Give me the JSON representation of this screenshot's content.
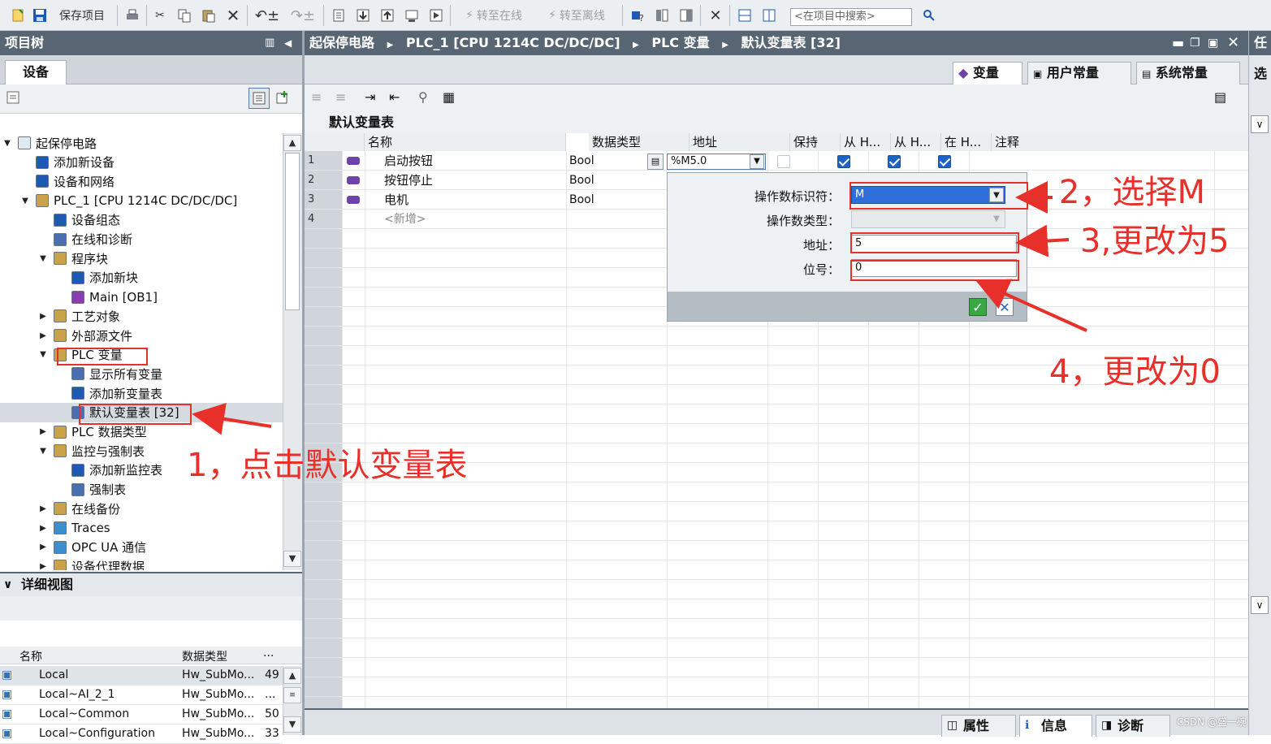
{
  "toolbar": {
    "save_project": "保存项目",
    "go_online": "转至在线",
    "go_offline": "转至离线",
    "search_placeholder": "<在项目中搜索>"
  },
  "project_tree": {
    "title": "项目树",
    "tab_devices": "设备",
    "items": [
      {
        "label": "起保停电路",
        "level": 0,
        "expand": "open"
      },
      {
        "label": "添加新设备",
        "level": 1,
        "expand": "none"
      },
      {
        "label": "设备和网络",
        "level": 1,
        "expand": "none"
      },
      {
        "label": "PLC_1 [CPU 1214C DC/DC/DC]",
        "level": 1,
        "expand": "open"
      },
      {
        "label": "设备组态",
        "level": 2,
        "expand": "none"
      },
      {
        "label": "在线和诊断",
        "level": 2,
        "expand": "none"
      },
      {
        "label": "程序块",
        "level": 2,
        "expand": "open"
      },
      {
        "label": "添加新块",
        "level": 3,
        "expand": "none"
      },
      {
        "label": "Main [OB1]",
        "level": 3,
        "expand": "none"
      },
      {
        "label": "工艺对象",
        "level": 2,
        "expand": "closed"
      },
      {
        "label": "外部源文件",
        "level": 2,
        "expand": "closed"
      },
      {
        "label": "PLC 变量",
        "level": 2,
        "expand": "open"
      },
      {
        "label": "显示所有变量",
        "level": 3,
        "expand": "none"
      },
      {
        "label": "添加新变量表",
        "level": 3,
        "expand": "none"
      },
      {
        "label": "默认变量表 [32]",
        "level": 3,
        "expand": "none",
        "selected": true
      },
      {
        "label": "PLC 数据类型",
        "level": 2,
        "expand": "closed"
      },
      {
        "label": "监控与强制表",
        "level": 2,
        "expand": "open"
      },
      {
        "label": "添加新监控表",
        "level": 3,
        "expand": "none"
      },
      {
        "label": "强制表",
        "level": 3,
        "expand": "none"
      },
      {
        "label": "在线备份",
        "level": 2,
        "expand": "closed"
      },
      {
        "label": "Traces",
        "level": 2,
        "expand": "closed"
      },
      {
        "label": "OPC UA 通信",
        "level": 2,
        "expand": "closed"
      },
      {
        "label": "设备代理数据",
        "level": 2,
        "expand": "closed"
      }
    ]
  },
  "detail_view": {
    "title": "详细视图",
    "col_name": "名称",
    "col_type": "数据类型",
    "col_extra": "...",
    "rows": [
      {
        "name": "Local",
        "type": "Hw_SubMo...",
        "extra": "49"
      },
      {
        "name": "Local~AI_2_1",
        "type": "Hw_SubMo...",
        "extra": "..."
      },
      {
        "name": "Local~Common",
        "type": "Hw_SubMo...",
        "extra": "50"
      },
      {
        "name": "Local~Configuration",
        "type": "Hw_SubMo...",
        "extra": "33"
      }
    ]
  },
  "editor": {
    "breadcrumb": [
      "起保停电路",
      "PLC_1 [CPU 1214C DC/DC/DC]",
      "PLC 变量",
      "默认变量表 [32]"
    ],
    "tabs": [
      "变量",
      "用户常量",
      "系统常量"
    ],
    "table_title": "默认变量表",
    "columns": [
      "名称",
      "数据类型",
      "地址",
      "保持",
      "从 H...",
      "从 H...",
      "在 H...",
      "注释"
    ],
    "rows": [
      {
        "num": "1",
        "name": "启动按钮",
        "type": "Bool",
        "address": "%M5.0",
        "retain": false,
        "hmi1": true,
        "hmi2": true,
        "hmi3": true
      },
      {
        "num": "2",
        "name": "按钮停止",
        "type": "Bool"
      },
      {
        "num": "3",
        "name": "电机",
        "type": "Bool"
      },
      {
        "num": "4",
        "name": "<新增>",
        "type": ""
      }
    ]
  },
  "address_popup": {
    "operand_id_label": "操作数标识符：",
    "operand_id_value": "M",
    "operand_type_label": "操作数类型：",
    "address_label": "地址：",
    "address_value": "5",
    "bit_label": "位号：",
    "bit_value": "0"
  },
  "side_strip": {
    "task_label": "任",
    "options_label": "选"
  },
  "bottom_tabs": [
    "属性",
    "信息",
    "诊断"
  ],
  "watermark": "CSDN @盛一碗",
  "annotations": {
    "step1": "1，点击默认变量表",
    "step2": "2，选择M",
    "step3": "3,更改为5",
    "step4": "4，更改为0"
  },
  "colors": {
    "header_bar": "#586673",
    "annotation_red": "#e8302a",
    "selection_blue": "#2f6fdc",
    "checkbox_blue": "#1d63c6"
  }
}
